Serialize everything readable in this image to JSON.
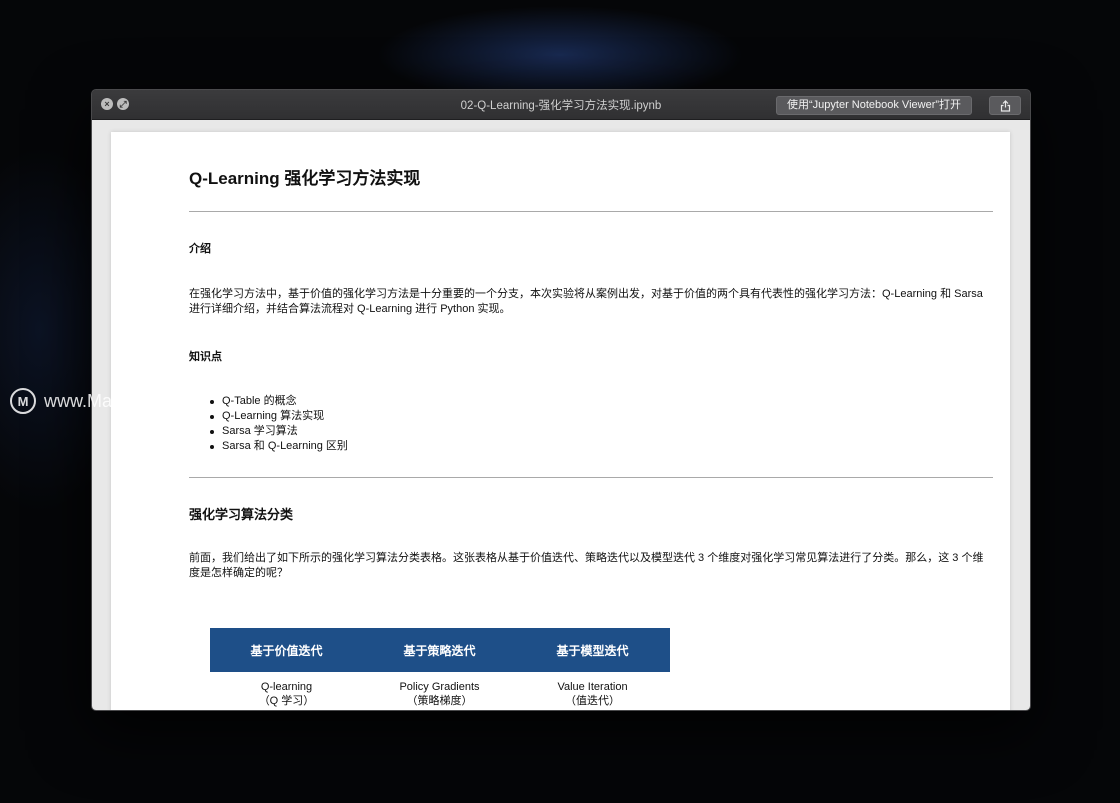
{
  "window": {
    "title": "02-Q-Learning-强化学习方法实现.ipynb",
    "open_button": "使用“Jupyter Notebook Viewer”打开",
    "close_icon": "close-icon",
    "fullscreen_icon": "fullscreen-icon",
    "share_icon": "share-icon"
  },
  "notebook": {
    "title": "Q-Learning 强化学习方法实现",
    "intro_heading": "介绍",
    "intro_text": "在强化学习方法中，基于价值的强化学习方法是十分重要的一个分支，本次实验将从案例出发，对基于价值的两个具有代表性的强化学习方法：Q-Learning 和 Sarsa 进行详细介绍，并结合算法流程对 Q-Learning 进行 Python 实现。",
    "knowledge_heading": "知识点",
    "knowledge_items": [
      "Q-Table 的概念",
      "Q-Learning 算法实现",
      "Sarsa 学习算法",
      "Sarsa 和 Q-Learning 区别"
    ],
    "section_heading": "强化学习算法分类",
    "section_text": "前面，我们给出了如下所示的强化学习算法分类表格。这张表格从基于价值迭代、策略迭代以及模型迭代 3 个维度对强化学习常见算法进行了分类。那么，这 3 个维度是怎样确定的呢？",
    "table": {
      "headers": [
        "基于价值迭代",
        "基于策略迭代",
        "基于模型迭代"
      ],
      "row1_main": [
        "Q-learning",
        "Policy Gradients",
        "Value Iteration"
      ],
      "row1_sub": [
        "（Q 学习）",
        "（策略梯度）",
        "（值迭代）"
      ]
    }
  },
  "watermark": {
    "text": "www.MacDown.com",
    "logo_letter": "M"
  },
  "colors": {
    "table_header": "#1e4f88",
    "titlebar": "#303032"
  }
}
